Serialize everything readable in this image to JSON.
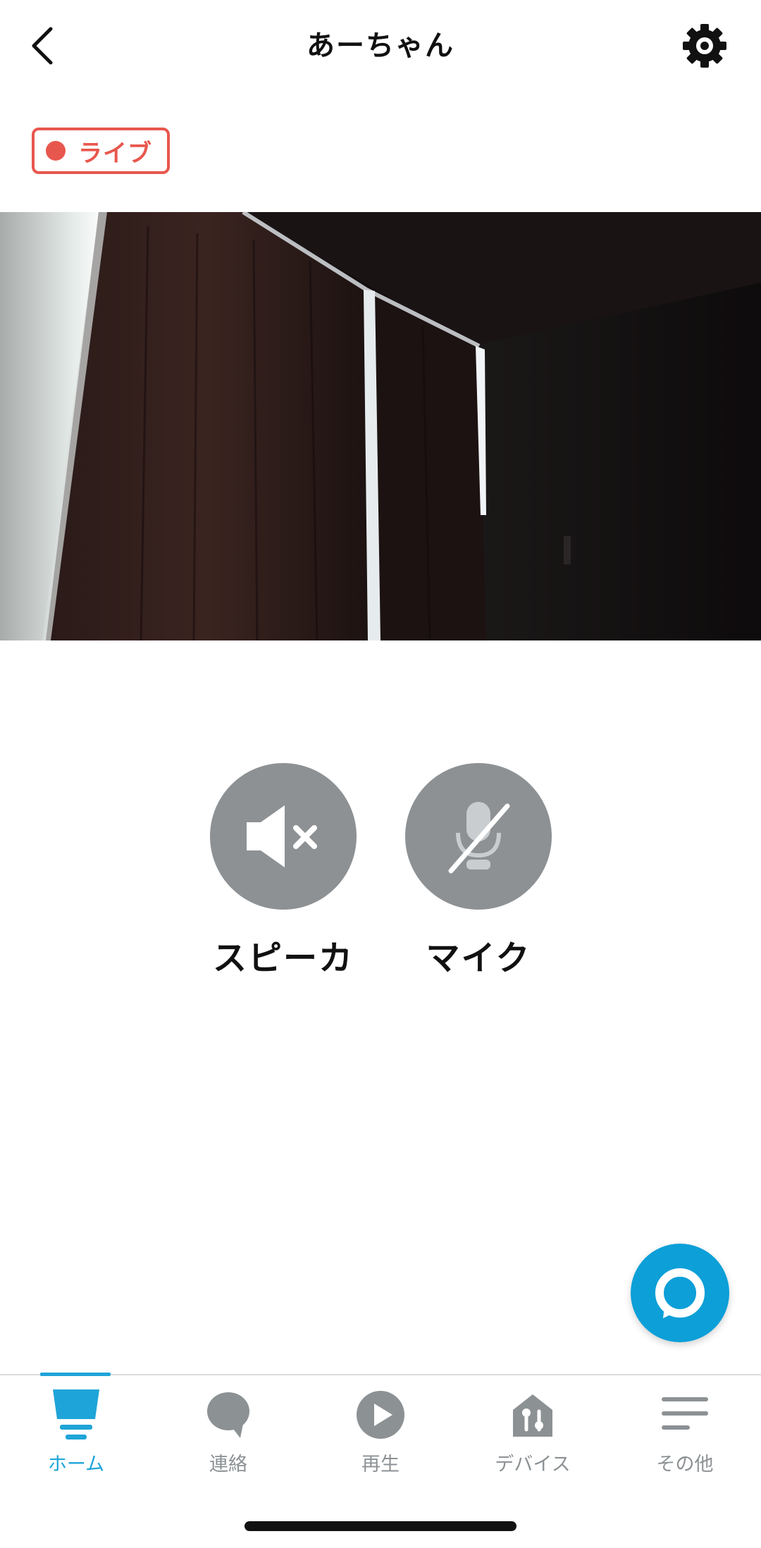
{
  "header": {
    "title": "あーちゃん",
    "back_icon": "chevron-left-icon",
    "settings_icon": "gear-icon"
  },
  "live_badge": {
    "label": "ライブ",
    "color": "#e8574e"
  },
  "controls": {
    "speaker": {
      "label": "スピーカ",
      "icon": "speaker-muted-icon"
    },
    "mic": {
      "label": "マイク",
      "icon": "microphone-off-icon"
    }
  },
  "fab": {
    "icon": "alexa-icon",
    "color": "#0c9fd8"
  },
  "tabs": [
    {
      "label": "ホーム",
      "icon": "home-icon",
      "active": true
    },
    {
      "label": "連絡",
      "icon": "chat-bubble-icon",
      "active": false
    },
    {
      "label": "再生",
      "icon": "play-icon",
      "active": false
    },
    {
      "label": "デバイス",
      "icon": "devices-icon",
      "active": false
    },
    {
      "label": "その他",
      "icon": "menu-icon",
      "active": false
    }
  ],
  "colors": {
    "accent": "#1ea4d8",
    "inactive": "#8c9194",
    "control": "#8d9194"
  }
}
